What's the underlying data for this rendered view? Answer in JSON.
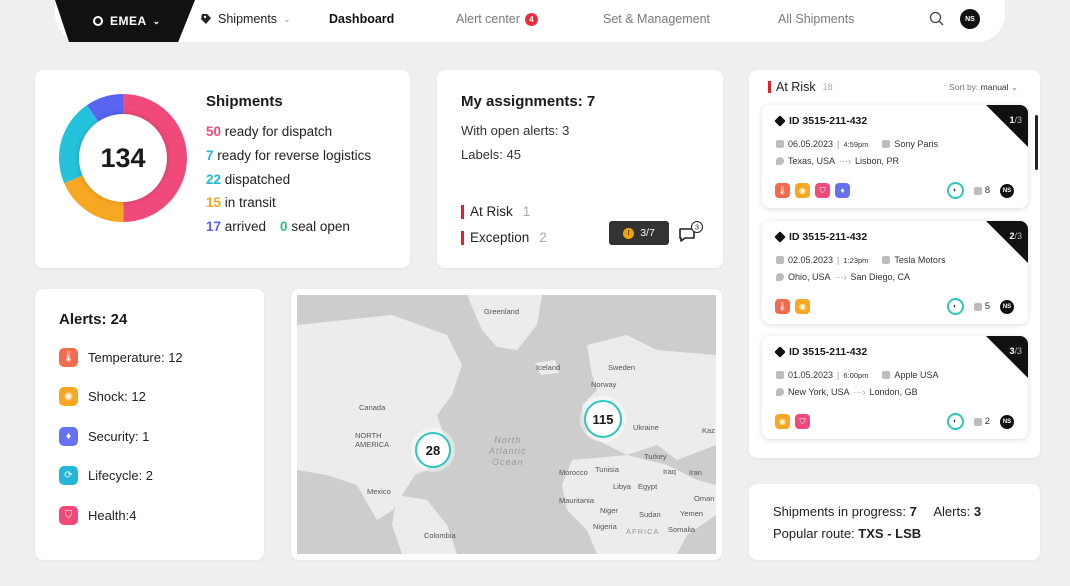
{
  "nav": {
    "region": "EMEA",
    "shipments": "Shipments",
    "dashboard": "Dashboard",
    "alert_center": "Alert center",
    "alert_center_count": "4",
    "set_management": "Set & Management",
    "all_shipments": "All Shipments",
    "user_initials": "NS"
  },
  "shipments_card": {
    "title": "Shipments",
    "total": "134",
    "lines": [
      {
        "count": "50",
        "label": " ready for dispatch",
        "color": "#f04a7b"
      },
      {
        "count": "7",
        "label": " ready for reverse logistics",
        "color": "#1fb9d5"
      },
      {
        "count": "22",
        "label": " dispatched",
        "color": "#1fb9d5"
      },
      {
        "count": "15",
        "label": " in transit",
        "color": "#f5a623"
      },
      {
        "count": "17",
        "label": " arrived",
        "color": "#5664f2"
      }
    ],
    "seal": {
      "count": "0",
      "label": " seal open",
      "color": "#2ec27e"
    },
    "donut_colors": {
      "pink": "#f04a7b",
      "cyan": "#25c2dc",
      "orange": "#f7a823",
      "blue": "#5965f0"
    }
  },
  "assignments": {
    "title": "My assignments: 7",
    "open_alerts": "With open alerts: 3",
    "labels": "Labels: 45",
    "at_risk_label": "At Risk",
    "at_risk_count": "1",
    "exception_label": "Exception",
    "exception_count": "2",
    "progress": "3/7",
    "comments": "3"
  },
  "alerts": {
    "title": "Alerts: 24",
    "items": [
      {
        "label": "Temperature: 12",
        "icon": "thermometer-icon",
        "color": "#f26b4f"
      },
      {
        "label": "Shock: 12",
        "icon": "shock-icon",
        "color": "#f7a823"
      },
      {
        "label": "Security: 1",
        "icon": "security-icon",
        "color": "#6672f2"
      },
      {
        "label": "Lifecycle: 2",
        "icon": "lifecycle-icon",
        "color": "#25b5d6"
      },
      {
        "label": "Health:4",
        "icon": "health-icon",
        "color": "#f04a7b"
      }
    ]
  },
  "map": {
    "labels": {
      "greenland": "Greenland",
      "iceland": "Iceland",
      "sweden": "Sweden",
      "norway": "Norway",
      "canada": "Canada",
      "north_america": "NORTH\nAMERICA",
      "north_atlantic": "North\nAtlantic\nOcean",
      "ukraine": "Ukraine",
      "kaz": "Kaz",
      "turkey": "Turkey",
      "tunisia": "Tunisia",
      "morocco": "Morocco",
      "iraq": "Iraq",
      "iran": "Iran",
      "libya": "Libya",
      "egypt": "Egypt",
      "mexico": "Mexico",
      "mauritania": "Mauritania",
      "oman": "Oman",
      "niger": "Niger",
      "sudan": "Sudan",
      "yemen": "Yemen",
      "nigeria": "Nigeria",
      "africa": "AFRICA",
      "somalia": "Somalia",
      "colombia": "Colombia"
    },
    "clusters": [
      {
        "value": "28"
      },
      {
        "value": "115"
      }
    ]
  },
  "at_risk": {
    "title": "At Risk",
    "count": "18",
    "sort_label": "Sort by:",
    "sort_value": "manual",
    "items": [
      {
        "id": "ID 3515-211-432",
        "index": "1",
        "total": "/3",
        "date": "06.05.2023",
        "time": "4:59pm",
        "company": "Sony Paris",
        "from": "Texas, USA",
        "to": "Lisbon, PR",
        "docs": "8",
        "icons": [
          "thermometer",
          "shock",
          "health",
          "security"
        ]
      },
      {
        "id": "ID 3515-211-432",
        "index": "2",
        "total": "/3",
        "date": "02.05.2023",
        "time": "1:23pm",
        "company": "Tesla Motors",
        "from": "Ohio, USA",
        "to": "San Diego, CA",
        "docs": "5",
        "icons": [
          "thermometer",
          "shock"
        ]
      },
      {
        "id": "ID 3515-211-432",
        "index": "3",
        "total": "/3",
        "date": "01.05.2023",
        "time": "6:00pm",
        "company": "Apple USA",
        "from": "New York, USA",
        "to": "London, GB",
        "docs": "2",
        "icons": [
          "shock",
          "health"
        ]
      }
    ],
    "initials": "NS"
  },
  "summary": {
    "in_progress_label": "Shipments in progress:",
    "in_progress_value": "7",
    "alerts_label": "Alerts:",
    "alerts_value": "3",
    "route_label": "Popular route:",
    "route_value": "TXS - LSB"
  }
}
